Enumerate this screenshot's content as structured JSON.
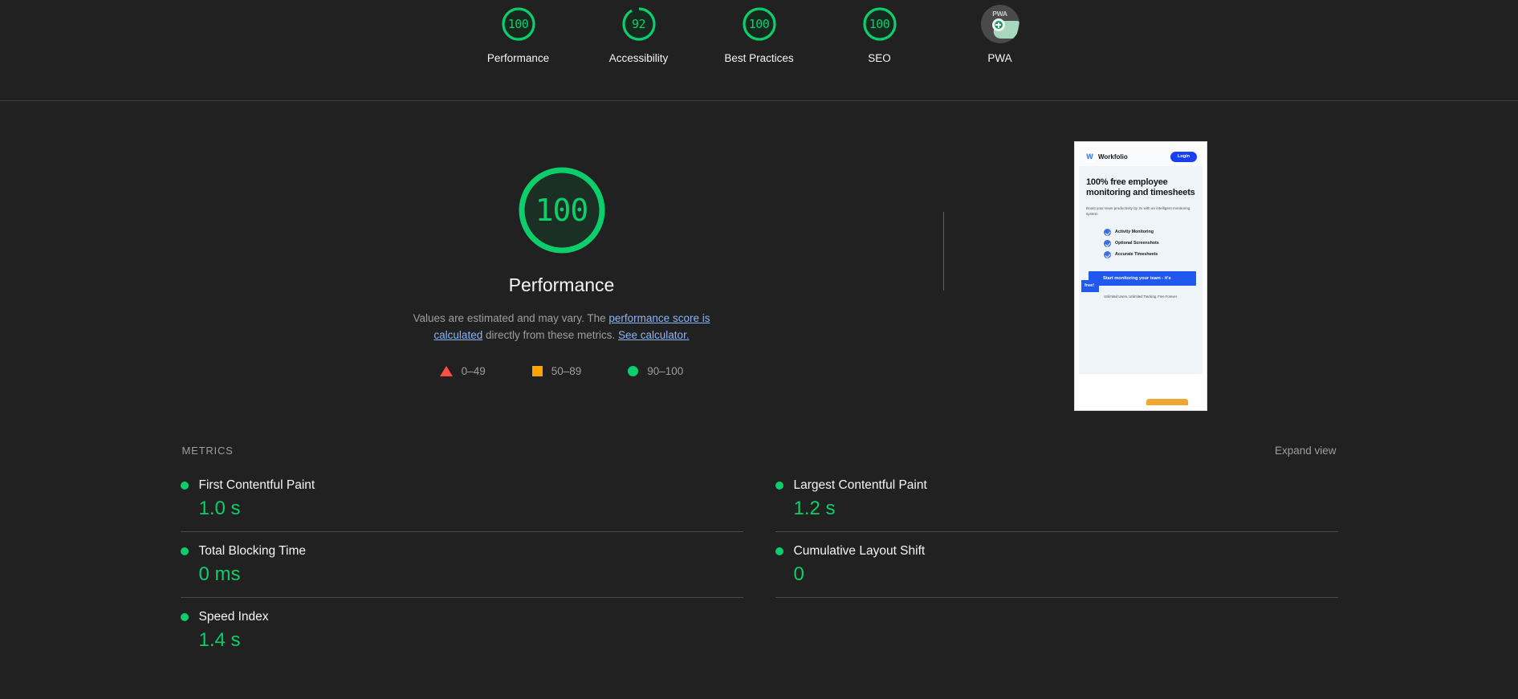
{
  "scores": [
    {
      "label": "Performance",
      "value": "100",
      "pct": 100,
      "color": "#0cce6b",
      "icon": "gauge-icon"
    },
    {
      "label": "Accessibility",
      "value": "92",
      "pct": 92,
      "color": "#0cce6b",
      "icon": "gauge-icon"
    },
    {
      "label": "Best Practices",
      "value": "100",
      "pct": 100,
      "color": "#0cce6b",
      "icon": "gauge-icon"
    },
    {
      "label": "SEO",
      "value": "100",
      "pct": 100,
      "color": "#0cce6b",
      "icon": "gauge-icon"
    },
    {
      "label": "PWA",
      "value": "PWA",
      "pct": 0,
      "color": "#4a4a4a",
      "icon": "pwa-badge-icon"
    }
  ],
  "category": {
    "score": "100",
    "title": "Performance",
    "disclaimer_pre": "Values are estimated and may vary. The ",
    "link1": "performance score is calculated",
    "disclaimer_mid": " directly from these metrics. ",
    "link2": "See calculator."
  },
  "legend": [
    {
      "shape": "triangle",
      "range": "0–49",
      "color": "#ff4e42"
    },
    {
      "shape": "square",
      "range": "50–89",
      "color": "#ffa400"
    },
    {
      "shape": "circle",
      "range": "90–100",
      "color": "#0cce6b"
    }
  ],
  "thumbnail": {
    "brand": "Workfolio",
    "logo_letter": "W",
    "login_label": "Login",
    "headline": "100% free employee monitoring and timesheets",
    "subhead": "Boost your team productivity by 2x with an intelligent monitoring system",
    "features": [
      "Activity Monitoring",
      "Optional Screenshots",
      "Accurate Timesheets"
    ],
    "cta": "Start monitoring your team - it's",
    "cta2": "free!",
    "note": "Unlimited Users. Unlimited Tracking. Free Forever."
  },
  "metrics_section": {
    "title": "METRICS",
    "expand_label": "Expand view",
    "items": [
      {
        "name": "First Contentful Paint",
        "value": "1.0 s",
        "status": "pass"
      },
      {
        "name": "Largest Contentful Paint",
        "value": "1.2 s",
        "status": "pass"
      },
      {
        "name": "Total Blocking Time",
        "value": "0 ms",
        "status": "pass"
      },
      {
        "name": "Cumulative Layout Shift",
        "value": "0",
        "status": "pass"
      },
      {
        "name": "Speed Index",
        "value": "1.4 s",
        "status": "pass"
      }
    ]
  }
}
